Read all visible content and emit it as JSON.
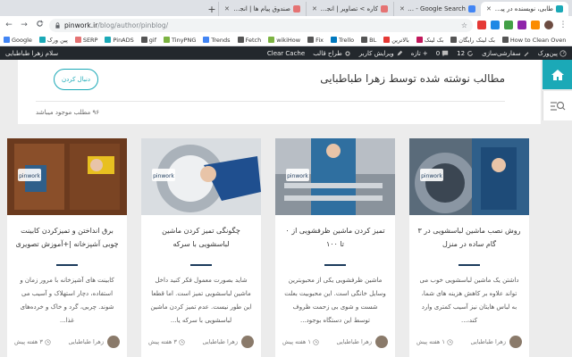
{
  "browser": {
    "tabs": [
      {
        "label": "طابی، نویسنده در پین‌وزگ",
        "active": true,
        "color": "#1ba9b7"
      },
      {
        "label": "pbn - Google Search ساری",
        "active": false,
        "color": "#4285f4"
      },
      {
        "label": "کاره > تصاویر | انجام میدم",
        "active": false,
        "color": "#e57373"
      },
      {
        "label": "صندوق پیام ها | انجام میدم",
        "active": false,
        "color": "#e57373"
      }
    ],
    "new_tab_label": "+",
    "url_host": "pinwork.ir",
    "url_path": "/blog/author/pinblog/",
    "nav": {
      "back": "←",
      "forward": "→",
      "reload": "C"
    },
    "bookmarks": [
      {
        "label": "Google",
        "color": "#4285f4"
      },
      {
        "label": "پین ورک",
        "color": "#1ba9b7"
      },
      {
        "label": "SERP",
        "color": "#e57373"
      },
      {
        "label": "PinADS",
        "color": "#1ba9b7"
      },
      {
        "label": "gif",
        "color": "#555"
      },
      {
        "label": "TinyPNG",
        "color": "#7cb342"
      },
      {
        "label": "Trends",
        "color": "#4285f4"
      },
      {
        "label": "Fetch",
        "color": "#555"
      },
      {
        "label": "wikiHow",
        "color": "#7cb342"
      },
      {
        "label": "Fix",
        "color": "#555"
      },
      {
        "label": "Trello",
        "color": "#0079bf"
      },
      {
        "label": "BL",
        "color": "#555"
      },
      {
        "label": "بالاترین",
        "color": "#e53935"
      },
      {
        "label": "بک لینک",
        "color": "#c2185b"
      },
      {
        "label": "بک لینک رایگان",
        "color": "#555"
      },
      {
        "label": "How to Clean Oven",
        "color": "#555"
      }
    ]
  },
  "wp_admin_bar": {
    "site": "پین‌ورک",
    "customize": "سفارشی‌سازی",
    "comments_count": "12",
    "pending_count": "0",
    "new_label": "تازه",
    "edit_user": "ویرایش کاربر",
    "theme_design": "طراح قالب",
    "clear_cache": "Clear Cache",
    "greeting": "سلام زهرا طباطبایی"
  },
  "author_header": {
    "title": "مطالب نوشته شده توسط زهرا طباطبایی",
    "follow_label": "دنبال کردن",
    "post_count": "۹۶ مطلب موجود میباشد"
  },
  "cards": [
    {
      "title": "روش نصب ماشین لباسشویی در ۳ گام ساده در منزل",
      "excerpt": "داشتن یک ماشین لباسشویی خوب می تواند علاوه بر کاهش هزینه های شما، به لباس هایتان نیز آسیب کمتری وارد کند،...",
      "author": "زهرا طباطبایی",
      "time": "۱ هفته پیش"
    },
    {
      "title": "تمیز کردن ماشین ظرفشویی از ۰ تا ۱۰۰",
      "excerpt": "ماشین ظرفشویی یکی از محبوبترین وسایل خانگی است. این محبوبیت بعلت شست و شوی بی زحمت ظروف توسط این دستگاه بوجود...",
      "author": "زهرا طباطبایی",
      "time": "۱ هفته پیش"
    },
    {
      "title": "چگونگی تمیز کردن ماشین لباسشویی با سرکه",
      "excerpt": "شاید بصورت معمول فکر کنید داخل ماشین لباسشویی تمیز است. اما قطعا این طور نیست. عدم تمیز کردن ماشین لباسشویی با سرکه یا...",
      "author": "زهرا طباطبایی",
      "time": "۳ هفته پیش"
    },
    {
      "title": "برق انداختن و تمیزکردن کابینت چوبی آشپزخانه |+آموزش تصویری",
      "excerpt": "کابینت های آشپزخانه با مرور زمان و استفاده، دچار استهلاک و آسیب می شوند. چربی، گرد و خاک و خرده‌های غذا...",
      "author": "زهرا طباطبایی",
      "time": "۳ هفته پیش"
    }
  ],
  "colors": {
    "accent": "#1ba9b7",
    "admin_bar": "#23282d"
  },
  "icons": {
    "home": "home-icon",
    "search": "search-icon"
  }
}
